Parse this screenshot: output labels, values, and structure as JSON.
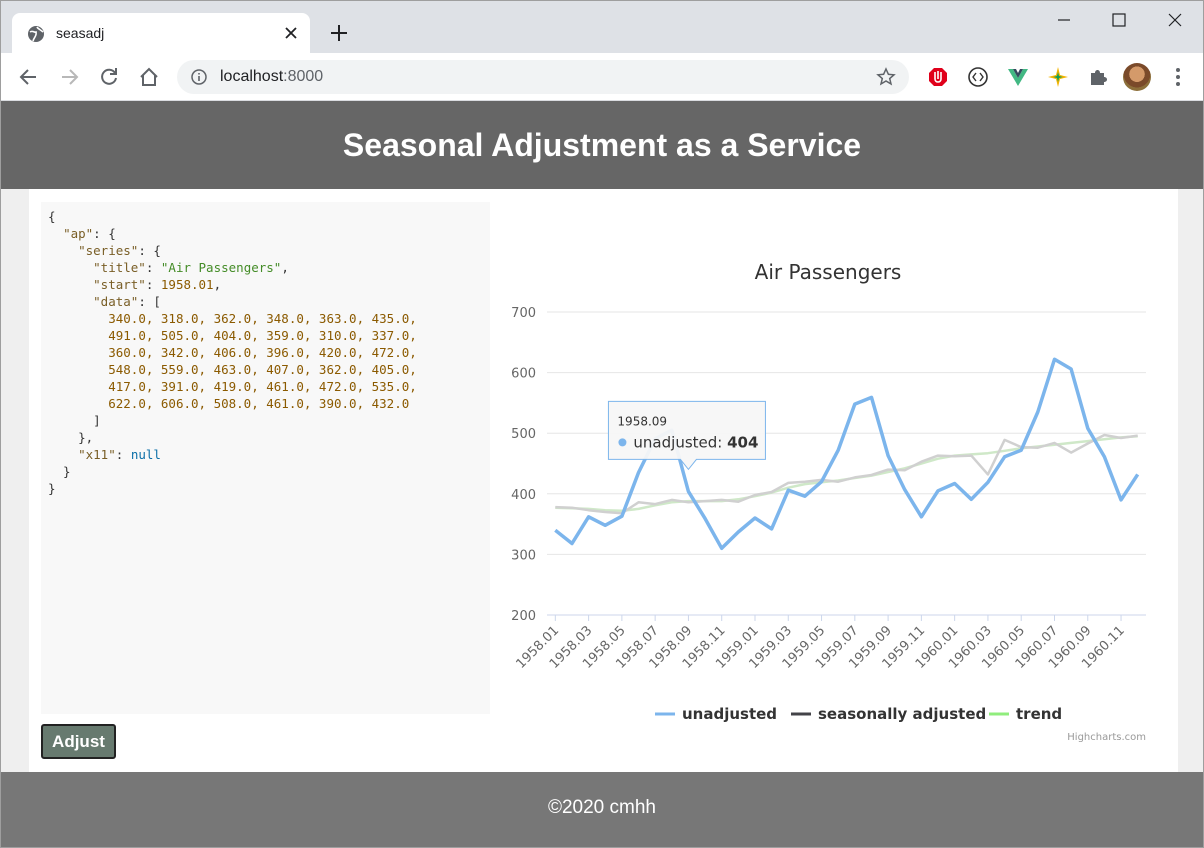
{
  "browser": {
    "tab_title": "seasadj",
    "url_host": "localhost",
    "url_port": ":8000"
  },
  "page": {
    "title": "Seasonal Adjustment as a Service",
    "adjust_button": "Adjust",
    "footer": "©2020 cmhh"
  },
  "code": {
    "key_ap": "\"ap\"",
    "key_series": "\"series\"",
    "key_title": "\"title\"",
    "title_value": "\"Air Passengers\"",
    "key_start": "\"start\"",
    "start_value": "1958.01",
    "key_data": "\"data\"",
    "data_lines": [
      "340.0, 318.0, 362.0, 348.0, 363.0, 435.0,",
      "491.0, 505.0, 404.0, 359.0, 310.0, 337.0,",
      "360.0, 342.0, 406.0, 396.0, 420.0, 472.0,",
      "548.0, 559.0, 463.0, 407.0, 362.0, 405.0,",
      "417.0, 391.0, 419.0, 461.0, 472.0, 535.0,",
      "622.0, 606.0, 508.0, 461.0, 390.0, 432.0"
    ],
    "key_x11": "\"x11\"",
    "x11_value": "null"
  },
  "chart_data": {
    "type": "line",
    "title": "Air Passengers",
    "x": [
      "1958.01",
      "1958.02",
      "1958.03",
      "1958.04",
      "1958.05",
      "1958.06",
      "1958.07",
      "1958.08",
      "1958.09",
      "1958.10",
      "1958.11",
      "1958.12",
      "1959.01",
      "1959.02",
      "1959.03",
      "1959.04",
      "1959.05",
      "1959.06",
      "1959.07",
      "1959.08",
      "1959.09",
      "1959.10",
      "1959.11",
      "1959.12",
      "1960.01",
      "1960.02",
      "1960.03",
      "1960.04",
      "1960.05",
      "1960.06",
      "1960.07",
      "1960.08",
      "1960.09",
      "1960.10",
      "1960.11",
      "1960.12"
    ],
    "x_tick_labels": [
      "1958.01",
      "1958.03",
      "1958.05",
      "1958.07",
      "1958.09",
      "1958.11",
      "1959.01",
      "1959.03",
      "1959.05",
      "1959.07",
      "1959.09",
      "1959.11",
      "1960.01",
      "1960.03",
      "1960.05",
      "1960.07",
      "1960.09",
      "1960.11"
    ],
    "ylim": [
      200,
      700
    ],
    "y_ticks": [
      200,
      300,
      400,
      500,
      600,
      700
    ],
    "grid": true,
    "legend_position": "bottom",
    "series": [
      {
        "name": "unadjusted",
        "color": "#7cb5ec",
        "values": [
          340,
          318,
          362,
          348,
          363,
          435,
          491,
          505,
          404,
          359,
          310,
          337,
          360,
          342,
          406,
          396,
          420,
          472,
          548,
          559,
          463,
          407,
          362,
          405,
          417,
          391,
          419,
          461,
          472,
          535,
          622,
          606,
          508,
          461,
          390,
          432
        ]
      },
      {
        "name": "seasonally adjusted",
        "color": "#434348",
        "values": [
          378,
          377,
          373,
          370,
          368,
          386,
          383,
          390,
          386,
          388,
          390,
          387,
          398,
          403,
          418,
          420,
          423,
          420,
          427,
          431,
          440,
          439,
          453,
          463,
          462,
          463,
          432,
          489,
          477,
          476,
          484,
          468,
          483,
          497,
          492,
          496
        ]
      },
      {
        "name": "trend",
        "color": "#90ed7d",
        "values": [
          377,
          376,
          375,
          373,
          372,
          375,
          381,
          386,
          388,
          388,
          388,
          391,
          396,
          402,
          410,
          416,
          419,
          422,
          426,
          430,
          436,
          442,
          450,
          458,
          463,
          465,
          467,
          471,
          475,
          478,
          481,
          484,
          487,
          490,
          493,
          495
        ]
      }
    ],
    "tooltip": {
      "x": "1958.09",
      "series": "unadjusted",
      "label": "unadjusted: ",
      "value": "404"
    },
    "credits": "Highcharts.com"
  }
}
